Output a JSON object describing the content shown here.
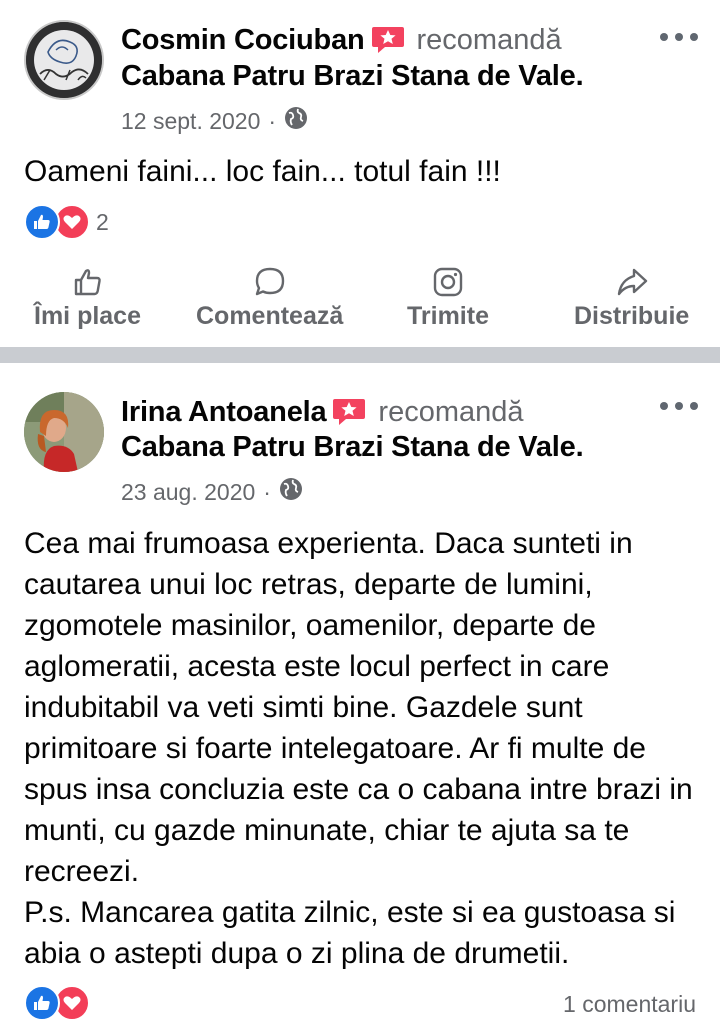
{
  "posts": [
    {
      "author": "Cosmin Cociuban",
      "recommend_word": "recomandă",
      "page": "Cabana Patru Brazi Stana de Vale",
      "date": "12 sept. 2020",
      "separator": "·",
      "privacy_icon": "globe-icon",
      "text": "Oameni faini... loc fain... totul fain !!!",
      "reaction_count": "2",
      "actions": {
        "like": "Îmi place",
        "comment": "Comentează",
        "send": "Trimite",
        "share": "Distribuie"
      }
    },
    {
      "author": "Irina Antoanela",
      "recommend_word": "recomandă",
      "page": "Cabana Patru Brazi Stana de Vale",
      "date": "23 aug. 2020",
      "separator": "·",
      "privacy_icon": "globe-icon",
      "text": "Cea mai frumoasa experienta. Daca sunteti in cautarea unui loc retras, departe de lumini, zgomotele masinilor, oamenilor, departe de aglomeratii, acesta este locul perfect in care indubitabil va veti simti bine. Gazdele sunt primitoare si foarte intelegatoare.  Ar fi multe de spus insa concluzia este ca o cabana intre brazi in munti, cu gazde minunate, chiar te ajuta sa te recreezi.\nP.s. Mancarea gatita zilnic, este si ea gustoasa si abia o astepti dupa o zi plina de drumetii.",
      "comments_count": "1 comentariu"
    }
  ],
  "colors": {
    "like_blue": "#1b74e4",
    "love_red": "#f33e58",
    "recommend_badge": "#f3425f",
    "secondary_text": "#65676b",
    "divider": "#c9ccd1"
  }
}
